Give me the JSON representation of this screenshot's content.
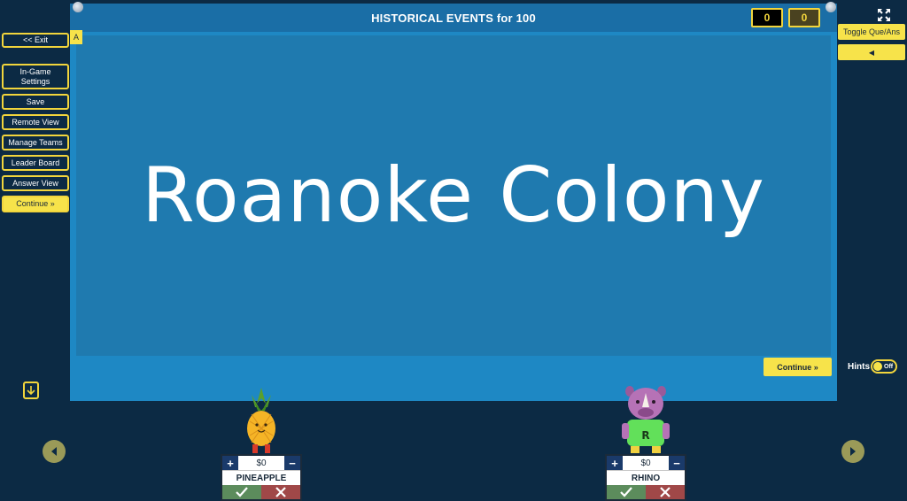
{
  "sidebar": {
    "exit": "<< Exit",
    "settings_line1": "In-Game",
    "settings_line2": "Settings",
    "save": "Save",
    "remote_view": "Remote View",
    "manage_teams": "Manage Teams",
    "leader_board": "Leader Board",
    "answer_view": "Answer View",
    "continue": "Continue »"
  },
  "board": {
    "title": "HISTORICAL EVENTS for 100",
    "score_a": "0",
    "score_b": "0",
    "marker": "A",
    "question": "Roanoke Colony",
    "continue": "Continue »"
  },
  "right": {
    "toggle": "Toggle Que/Ans",
    "audio": "◀",
    "hints_label": "Hints",
    "hints_state": "Off"
  },
  "teams": [
    {
      "name": "PINEAPPLE",
      "score": "$0"
    },
    {
      "name": "RHINO",
      "score": "$0"
    }
  ],
  "colors": {
    "background": "#0c2a44",
    "board": "#1e88c4",
    "accent": "#f7e34a"
  }
}
